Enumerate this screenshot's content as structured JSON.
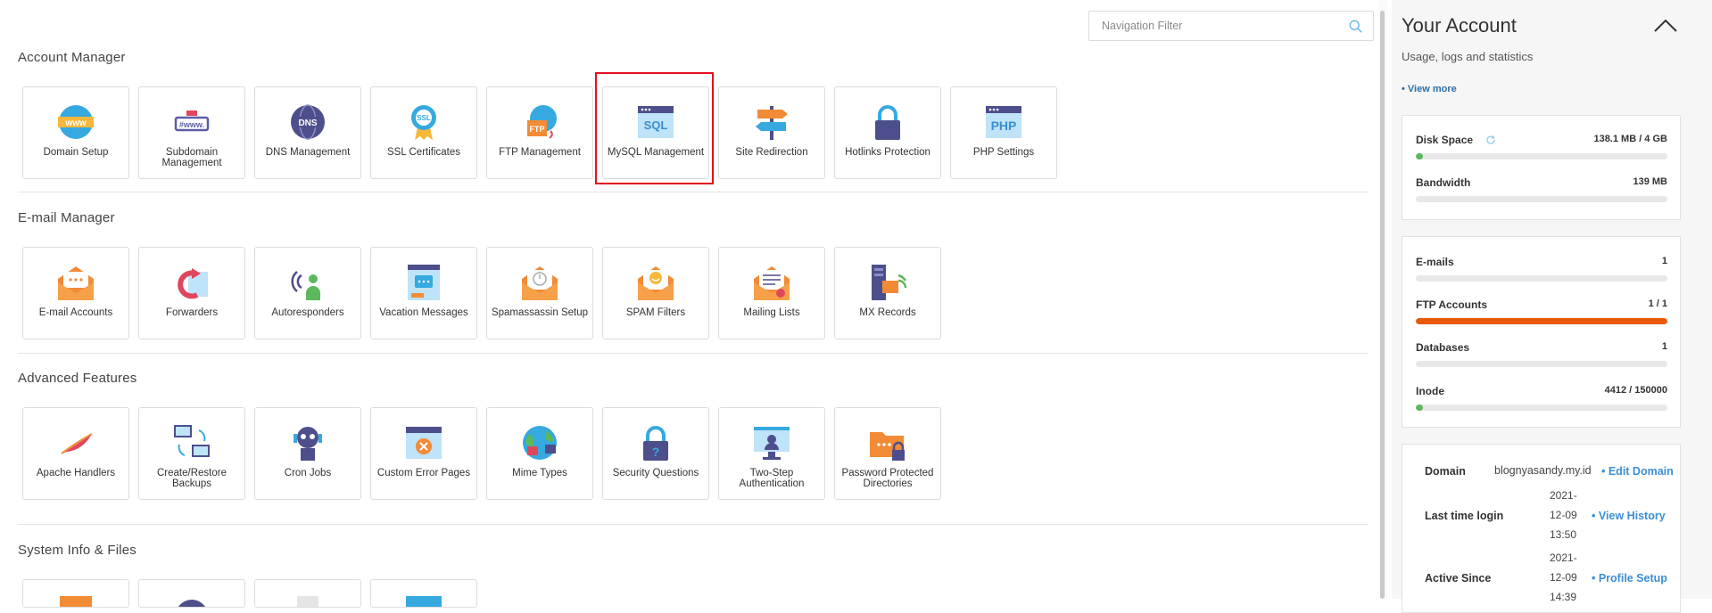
{
  "search": {
    "placeholder": "Navigation Filter"
  },
  "sections": {
    "account": {
      "title": "Account Manager",
      "items": [
        {
          "label": "Domain Setup",
          "icon": "www-globe-icon"
        },
        {
          "label": "Subdomain Management",
          "icon": "subdomain-icon"
        },
        {
          "label": "DNS Management",
          "icon": "dns-globe-icon"
        },
        {
          "label": "SSL Certificates",
          "icon": "ssl-badge-icon"
        },
        {
          "label": "FTP Management",
          "icon": "ftp-icon"
        },
        {
          "label": "MySQL Management",
          "icon": "sql-window-icon"
        },
        {
          "label": "Site Redirection",
          "icon": "signpost-icon"
        },
        {
          "label": "Hotlinks Protection",
          "icon": "padlock-icon"
        },
        {
          "label": "PHP Settings",
          "icon": "php-window-icon"
        }
      ]
    },
    "email": {
      "title": "E-mail Manager",
      "items": [
        {
          "label": "E-mail Accounts",
          "icon": "envelope-icon"
        },
        {
          "label": "Forwarders",
          "icon": "forward-mail-icon"
        },
        {
          "label": "Autoresponders",
          "icon": "autoresponder-icon"
        },
        {
          "label": "Vacation Messages",
          "icon": "vacation-message-icon"
        },
        {
          "label": "Spamassassin Setup",
          "icon": "spam-clock-icon"
        },
        {
          "label": "SPAM Filters",
          "icon": "spam-filter-icon"
        },
        {
          "label": "Mailing Lists",
          "icon": "mailing-list-icon"
        },
        {
          "label": "MX Records",
          "icon": "mx-server-icon"
        }
      ]
    },
    "advanced": {
      "title": "Advanced Features",
      "items": [
        {
          "label": "Apache Handlers",
          "icon": "feather-icon"
        },
        {
          "label": "Create/Restore Backups",
          "icon": "backup-icon"
        },
        {
          "label": "Cron Jobs",
          "icon": "robot-icon"
        },
        {
          "label": "Custom Error Pages",
          "icon": "error-page-icon"
        },
        {
          "label": "Mime Types",
          "icon": "mime-globe-icon"
        },
        {
          "label": "Security Questions",
          "icon": "question-lock-icon"
        },
        {
          "label": "Two-Step Authentication",
          "icon": "two-step-icon"
        },
        {
          "label": "Password Protected Directories",
          "icon": "locked-folder-icon"
        }
      ]
    },
    "system": {
      "title": "System Info & Files"
    }
  },
  "account_panel": {
    "title": "Your Account",
    "subtitle": "Usage, logs and statistics",
    "view_more": "• View more",
    "disk": {
      "label": "Disk Space",
      "value": "138.1 MB / 4 GB",
      "fill": 0.03,
      "color": "#5cb85c"
    },
    "bandwidth": {
      "label": "Bandwidth",
      "value": "139 MB",
      "fill": 0,
      "color": "#5cb85c"
    },
    "emails": {
      "label": "E-mails",
      "value": "1",
      "fill": 0,
      "color": "#5cb85c"
    },
    "ftp": {
      "label": "FTP Accounts",
      "value": "1 / 1",
      "fill": 1.0,
      "color": "#e8590c"
    },
    "databases": {
      "label": "Databases",
      "value": "1",
      "fill": 0,
      "color": "#5cb85c"
    },
    "inode": {
      "label": "Inode",
      "value": "4412 / 150000",
      "fill": 0.03,
      "color": "#5cb85c"
    },
    "domain": {
      "label": "Domain",
      "value": "blognyasandy.my.id",
      "link": "• Edit Domain"
    },
    "last_login": {
      "label": "Last time login",
      "v1": "2021-",
      "v2": "12-09",
      "v3": "13:50",
      "link": "• View History"
    },
    "active_since": {
      "label": "Active Since",
      "v1": "2021-",
      "v2": "12-09",
      "v3": "14:39",
      "link": "• Profile Setup"
    }
  }
}
